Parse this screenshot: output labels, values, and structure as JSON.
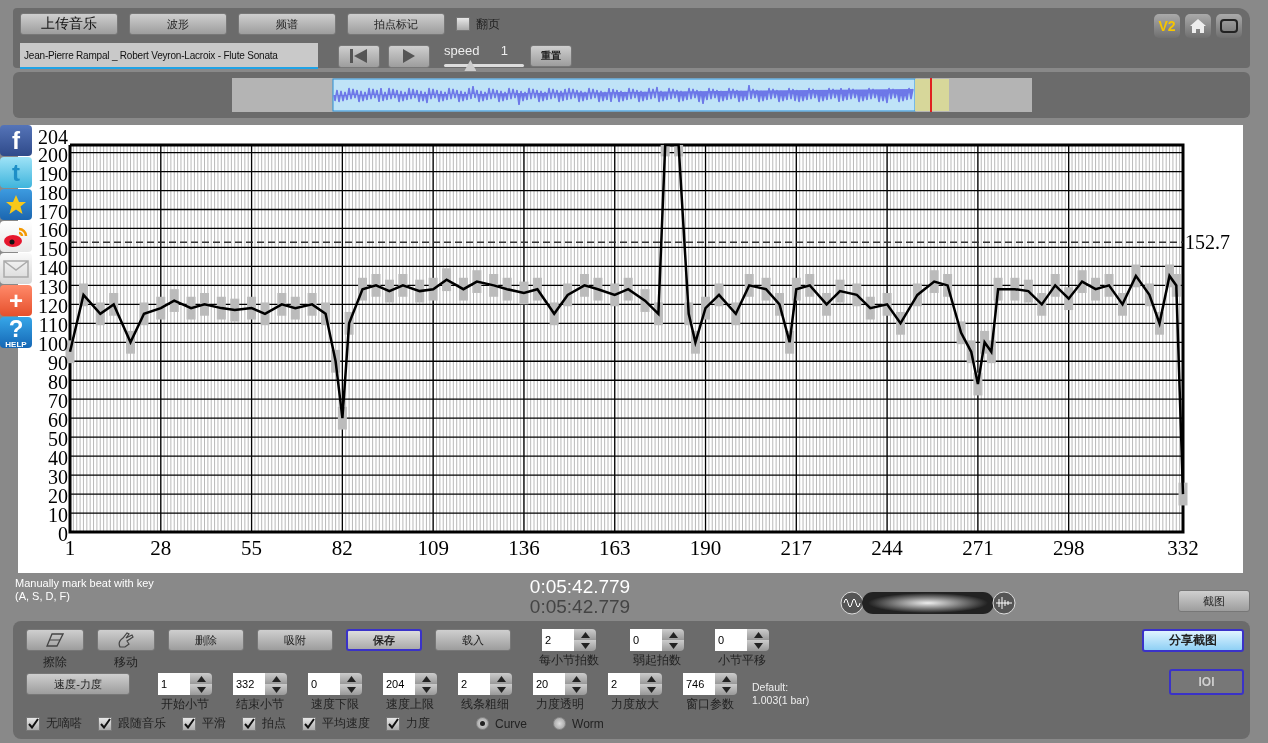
{
  "toolbar": {
    "buttons": [
      {
        "label": "上传音乐",
        "kind": "large"
      },
      {
        "label": "波形",
        "kind": "normal"
      },
      {
        "label": "频谱",
        "kind": "normal"
      },
      {
        "label": "拍点标记",
        "kind": "normal"
      }
    ],
    "page_flip": {
      "label": "翻页",
      "checked": false
    },
    "file_field": {
      "value": "Jean-Pierre Rampal _ Robert Veyron-Lacroix - Flute Sonata"
    },
    "speed": {
      "label": "speed",
      "value": "1",
      "level": 0.33
    },
    "reset_button": "重置",
    "version_badge": "V2"
  },
  "share_bar": [
    {
      "kind": "facebook",
      "label": "f"
    },
    {
      "kind": "twitter",
      "label": "t"
    },
    {
      "kind": "star"
    },
    {
      "kind": "weibo"
    },
    {
      "kind": "mail"
    },
    {
      "kind": "plus",
      "label": "+"
    },
    {
      "kind": "help",
      "label": "?",
      "sublabel": "HELP"
    }
  ],
  "tempo_chart": {
    "chart_data": {
      "type": "line",
      "xlim": [
        1,
        332
      ],
      "ylim": [
        0,
        204
      ],
      "xticks": [
        1,
        28,
        55,
        82,
        109,
        136,
        163,
        190,
        217,
        244,
        271,
        298,
        332
      ],
      "yticks": [
        0,
        10,
        20,
        30,
        40,
        50,
        60,
        70,
        80,
        90,
        100,
        110,
        120,
        130,
        140,
        150,
        160,
        170,
        180,
        190,
        200,
        204
      ],
      "x": [
        1,
        5,
        10,
        14,
        19,
        23,
        28,
        32,
        37,
        41,
        46,
        50,
        55,
        59,
        64,
        68,
        73,
        77,
        80,
        82,
        84,
        88,
        92,
        96,
        100,
        105,
        109,
        113,
        118,
        122,
        127,
        131,
        136,
        140,
        145,
        149,
        154,
        158,
        163,
        167,
        172,
        176,
        178,
        182,
        185,
        187,
        190,
        194,
        199,
        203,
        208,
        212,
        215,
        217,
        221,
        226,
        230,
        235,
        239,
        244,
        248,
        253,
        258,
        262,
        266,
        269,
        271,
        273,
        275,
        277,
        282,
        286,
        290,
        294,
        298,
        302,
        306,
        310,
        314,
        318,
        322,
        325,
        328,
        330,
        332
      ],
      "grid": true,
      "series": [
        {
          "color": "#000000",
          "errors": [
            6,
            6,
            6,
            6,
            6,
            6,
            6,
            6,
            6,
            6,
            6,
            6,
            6,
            6,
            6,
            6,
            6,
            6,
            6,
            6,
            6,
            6,
            6,
            6,
            6,
            6,
            6,
            6,
            6,
            6,
            6,
            6,
            6,
            6,
            6,
            6,
            6,
            6,
            6,
            6,
            6,
            6,
            6,
            6,
            6,
            6,
            6,
            6,
            6,
            6,
            6,
            6,
            6,
            6,
            6,
            6,
            6,
            6,
            6,
            6,
            6,
            6,
            6,
            6,
            6,
            6,
            6,
            6,
            6,
            6,
            6,
            6,
            6,
            6,
            6,
            6,
            6,
            6,
            6,
            6,
            6,
            6,
            6,
            6,
            6
          ],
          "values": [
            95,
            125,
            115,
            120,
            100,
            115,
            118,
            122,
            118,
            120,
            118,
            117,
            118,
            115,
            120,
            118,
            120,
            115,
            90,
            60,
            110,
            128,
            130,
            127,
            130,
            127,
            128,
            133,
            128,
            132,
            130,
            128,
            126,
            128,
            115,
            125,
            130,
            128,
            125,
            128,
            122,
            115,
            204,
            204,
            115,
            100,
            118,
            125,
            115,
            130,
            128,
            120,
            100,
            128,
            130,
            120,
            127,
            125,
            118,
            120,
            110,
            125,
            132,
            130,
            105,
            95,
            78,
            100,
            95,
            128,
            128,
            127,
            120,
            130,
            123,
            132,
            128,
            130,
            120,
            135,
            125,
            110,
            135,
            130,
            20
          ]
        }
      ],
      "ref_lines": [
        {
          "axis": "y",
          "value": 152.7,
          "label": "152.7"
        }
      ]
    }
  },
  "zoom_slider": {
    "level": 0.5
  },
  "hint": [
    "Manually mark beat with key",
    "(A, S, D, F)"
  ],
  "times": [
    "0:05:42.779",
    "0:05:42.779"
  ],
  "screenshot_button": "截图",
  "tools": [
    {
      "label": "擦除",
      "kind": "eraser",
      "selected": false
    },
    {
      "label": "移动",
      "kind": "move",
      "selected": false
    },
    {
      "label": "删除",
      "kind": "text",
      "selected": false
    },
    {
      "label": "吸附",
      "kind": "text",
      "selected": false
    },
    {
      "label": "保存",
      "kind": "text",
      "selected": true
    },
    {
      "label": "载入",
      "kind": "text",
      "selected": false
    }
  ],
  "beat_settings": [
    {
      "label": "每小节拍数",
      "value": "2"
    },
    {
      "label": "弱起拍数",
      "value": "0"
    },
    {
      "label": "小节平移",
      "value": "0"
    }
  ],
  "mode_button": "速度-力度",
  "range_settings": [
    {
      "label": "开始小节",
      "value": "1"
    },
    {
      "label": "结束小节",
      "value": "332"
    },
    {
      "label": "速度下限",
      "value": "0"
    },
    {
      "label": "速度上限",
      "value": "204"
    },
    {
      "label": "线条粗细",
      "value": "2"
    },
    {
      "label": "力度透明",
      "value": "20"
    },
    {
      "label": "力度放大",
      "value": "2"
    },
    {
      "label": "窗口参数",
      "value": "746"
    }
  ],
  "default_note": [
    "Default:",
    "1.003(1 bar)"
  ],
  "options": [
    {
      "label": "无嘀嗒",
      "kind": "checkbox",
      "checked": true
    },
    {
      "label": "跟随音乐",
      "kind": "checkbox",
      "checked": true
    },
    {
      "label": "平滑",
      "kind": "checkbox",
      "checked": true
    },
    {
      "label": "拍点",
      "kind": "checkbox",
      "checked": true
    },
    {
      "label": "平均速度",
      "kind": "checkbox",
      "checked": true
    },
    {
      "label": "力度",
      "kind": "checkbox",
      "checked": true
    },
    {
      "label": "Curve",
      "kind": "radio",
      "checked": true
    },
    {
      "label": "Worm",
      "kind": "radio",
      "checked": false
    }
  ],
  "share_screenshot_button": {
    "label": "分享截图",
    "disabled": false
  },
  "ioi_button": {
    "label": "IOI",
    "disabled": true
  }
}
